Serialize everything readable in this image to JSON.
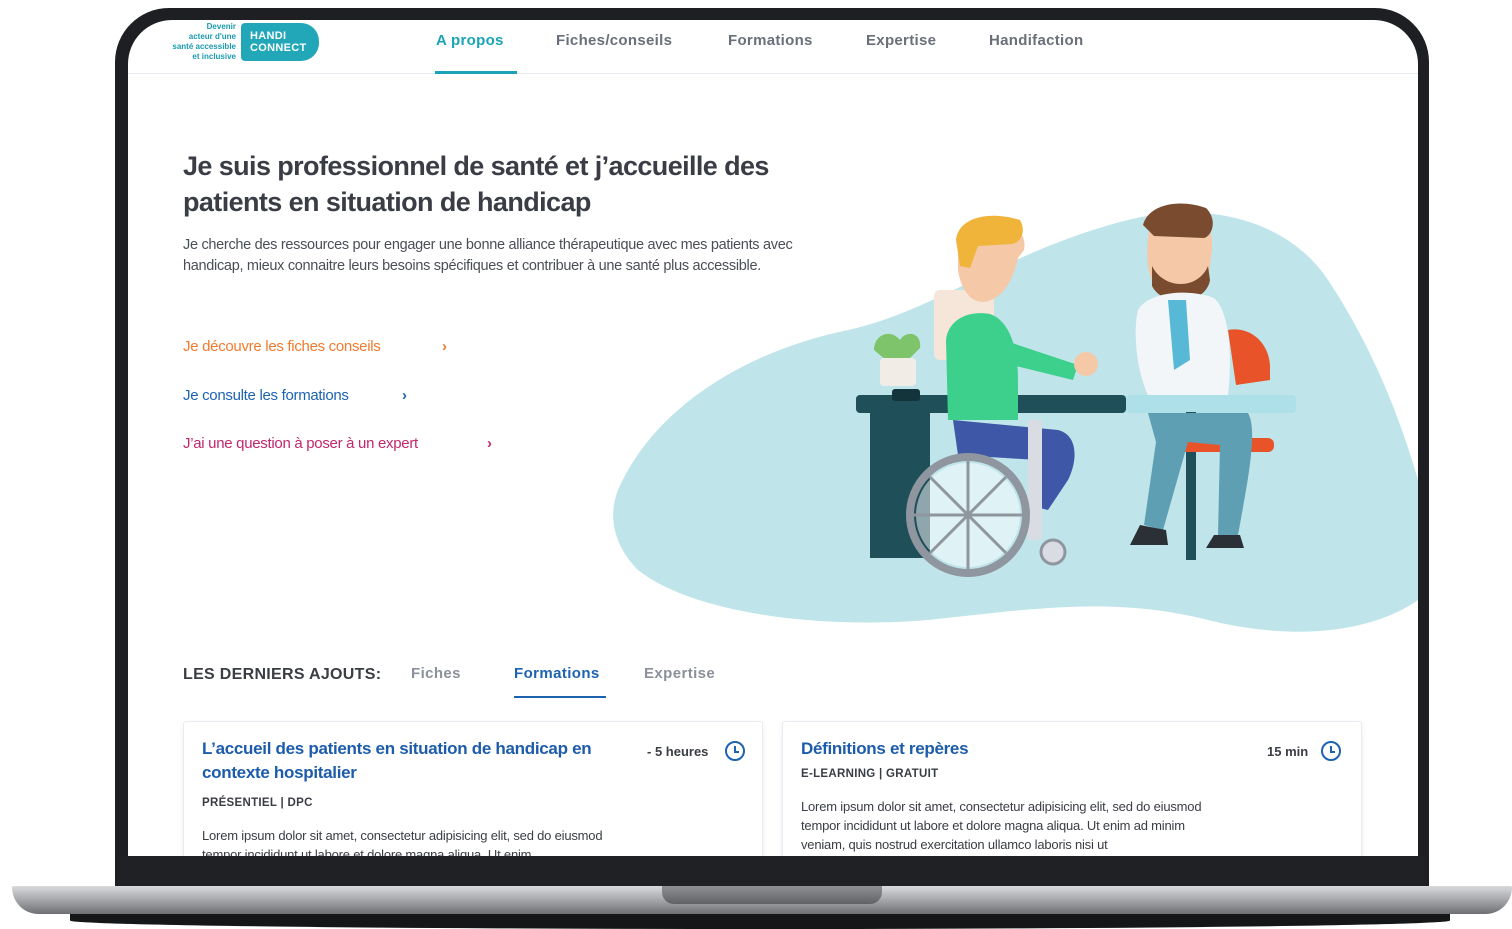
{
  "logo": {
    "tagline_lines": [
      "Devenir",
      "acteur d'une",
      "santé accessible",
      "et inclusive"
    ],
    "badge_line1": "HANDI",
    "badge_line2": "CONNECT"
  },
  "nav": {
    "items": [
      {
        "label": "A propos",
        "active": true
      },
      {
        "label": "Fiches/conseils",
        "active": false
      },
      {
        "label": "Formations",
        "active": false
      },
      {
        "label": "Expertise",
        "active": false
      },
      {
        "label": "Handifaction",
        "active": false
      }
    ]
  },
  "hero": {
    "title": "Je suis professionnel de santé et j’accueille des patients en situation de handicap",
    "description": "Je cherche des ressources pour engager une bonne alliance thérapeutique avec mes patients avec handicap, mieux connaitre leurs besoins spécifiques  et contribuer à une santé plus accessible.",
    "links": [
      {
        "label": "Je découvre les fiches conseils",
        "chevron": "›"
      },
      {
        "label": "Je consulte les formations",
        "chevron": "›"
      },
      {
        "label": "J’ai une question à poser à un expert",
        "chevron": "›"
      }
    ]
  },
  "latest": {
    "label": "LES DERNIERS AJOUTS:",
    "tabs": [
      {
        "label": "Fiches",
        "active": false
      },
      {
        "label": "Formations",
        "active": true
      },
      {
        "label": "Expertise",
        "active": false
      }
    ],
    "cards": [
      {
        "title": "L’accueil des patients en situation de handicap en contexte hospitalier",
        "duration": "- 5 heures",
        "meta": "PRÉSENTIEL | DPC",
        "body": "Lorem ipsum dolor sit amet, consectetur adipisicing elit, sed do eiusmod tempor incididunt ut labore et dolore magna aliqua. Ut enim"
      },
      {
        "title": "Définitions et repères",
        "duration": "15 min",
        "meta": "E-LEARNING | GRATUIT",
        "body": "Lorem ipsum dolor sit amet, consectetur adipisicing elit, sed do eiusmod tempor incididunt ut labore et dolore magna aliqua. Ut enim ad minim veniam, quis nostrud exercitation ullamco laboris nisi ut"
      }
    ]
  },
  "colors": {
    "teal": "#1aa3b6",
    "blue": "#1d63b0",
    "orange": "#f07a2e",
    "pink": "#c0286c"
  },
  "icons": {
    "chevron": "chevron-right-icon",
    "clock": "clock-icon"
  }
}
